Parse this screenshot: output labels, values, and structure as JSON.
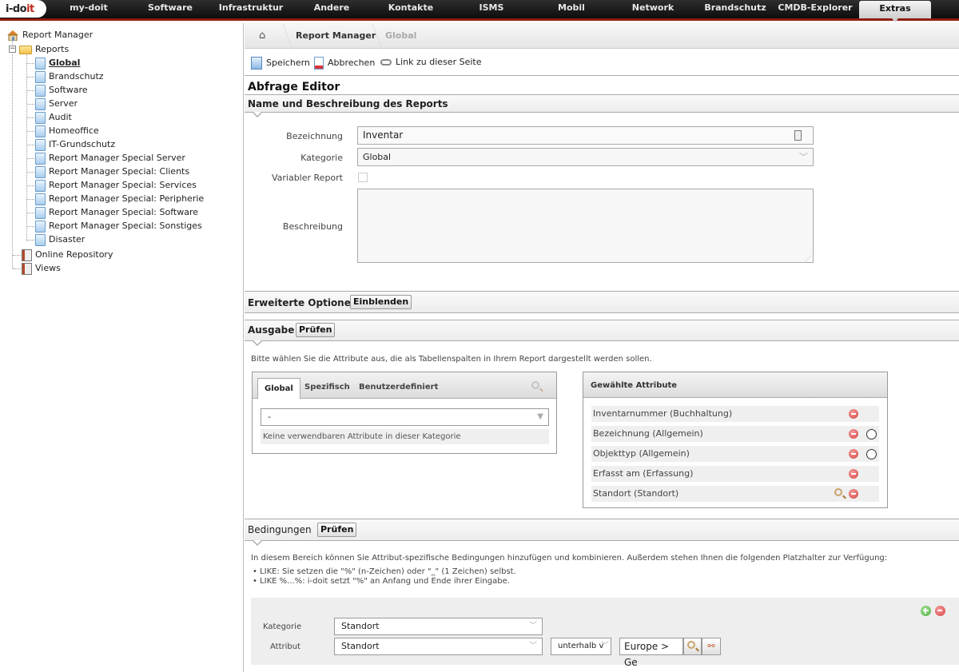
{
  "topnav": {
    "logo_main": "i-do",
    "logo_accent": "it",
    "items": [
      "my-doit",
      "Software",
      "Infrastruktur",
      "Andere",
      "Kontakte",
      "ISMS",
      "Mobil",
      "Network",
      "Brandschutz",
      "CMDB-Explorer",
      "Extras"
    ],
    "active": "Extras"
  },
  "sidebar": {
    "root": "Report Manager",
    "folder": "Reports",
    "reports": [
      "Global",
      "Brandschutz",
      "Software",
      "Server",
      "Audit",
      "Homeoffice",
      "IT-Grundschutz",
      "Report Manager Special Server",
      "Report Manager Special: Clients",
      "Report Manager Special: Services",
      "Report Manager Special: Peripherie",
      "Report Manager Special: Software",
      "Report Manager Special: Sonstiges",
      "Disaster"
    ],
    "selected": "Global",
    "extra": [
      "Online Repository",
      "Views"
    ]
  },
  "breadcrumb": {
    "items": [
      "Report Manager",
      "Global"
    ]
  },
  "toolbar": {
    "save": "Speichern",
    "cancel": "Abbrechen",
    "link": "Link zu dieser Seite"
  },
  "editor": {
    "title": "Abfrage Editor",
    "name_section": "Name und Beschreibung des Reports",
    "fields": {
      "bezeichnung_label": "Bezeichnung",
      "bezeichnung_value": "Inventar",
      "kategorie_label": "Kategorie",
      "kategorie_value": "Global",
      "variabler_label": "Variabler Report",
      "variabler_checked": false,
      "beschreibung_label": "Beschreibung",
      "beschreibung_value": ""
    },
    "advanced": {
      "title": "Erweiterte Optionen",
      "button": "Einblenden"
    },
    "output": {
      "title": "Ausgabe",
      "button": "Prüfen",
      "hint": "Bitte wählen Sie die Attribute aus, die als Tabellenspalten in Ihrem Report dargestellt werden sollen.",
      "tabs": [
        "Global",
        "Spezifisch",
        "Benutzerdefiniert"
      ],
      "active_tab": "Global",
      "select_value": "-",
      "empty_text": "Keine verwendbaren Attribute in dieser Kategorie",
      "selected_title": "Gewählte Attribute",
      "selected_attributes": [
        {
          "label": "Inventarnummer (Buchhaltung)",
          "search": false,
          "radio": false
        },
        {
          "label": "Bezeichnung (Allgemein)",
          "search": false,
          "radio": true
        },
        {
          "label": "Objekttyp (Allgemein)",
          "search": false,
          "radio": true
        },
        {
          "label": "Erfasst am (Erfassung)",
          "search": false,
          "radio": false
        },
        {
          "label": "Standort (Standort)",
          "search": true,
          "radio": false
        }
      ]
    },
    "conditions": {
      "title": "Bedingungen",
      "button": "Prüfen",
      "intro": "In diesem Bereich können Sie Attribut-spezifische Bedingungen hinzufügen und kombinieren. Außerdem stehen Ihnen die folgenden Platzhalter zur Verfügung:",
      "bullets": [
        "LIKE: Sie setzen die \"%\" (n-Zeichen) oder \"_\" (1 Zeichen) selbst.",
        "LIKE %...%: i-doit setzt \"%\" an Anfang und Ende ihrer Eingabe."
      ],
      "kategorie_label": "Kategorie",
      "kategorie_value": "Standort",
      "attribut_label": "Attribut",
      "attribut_value": "Standort",
      "operator_value": "unterhalb v",
      "value_text": "Europe > Ge"
    }
  }
}
